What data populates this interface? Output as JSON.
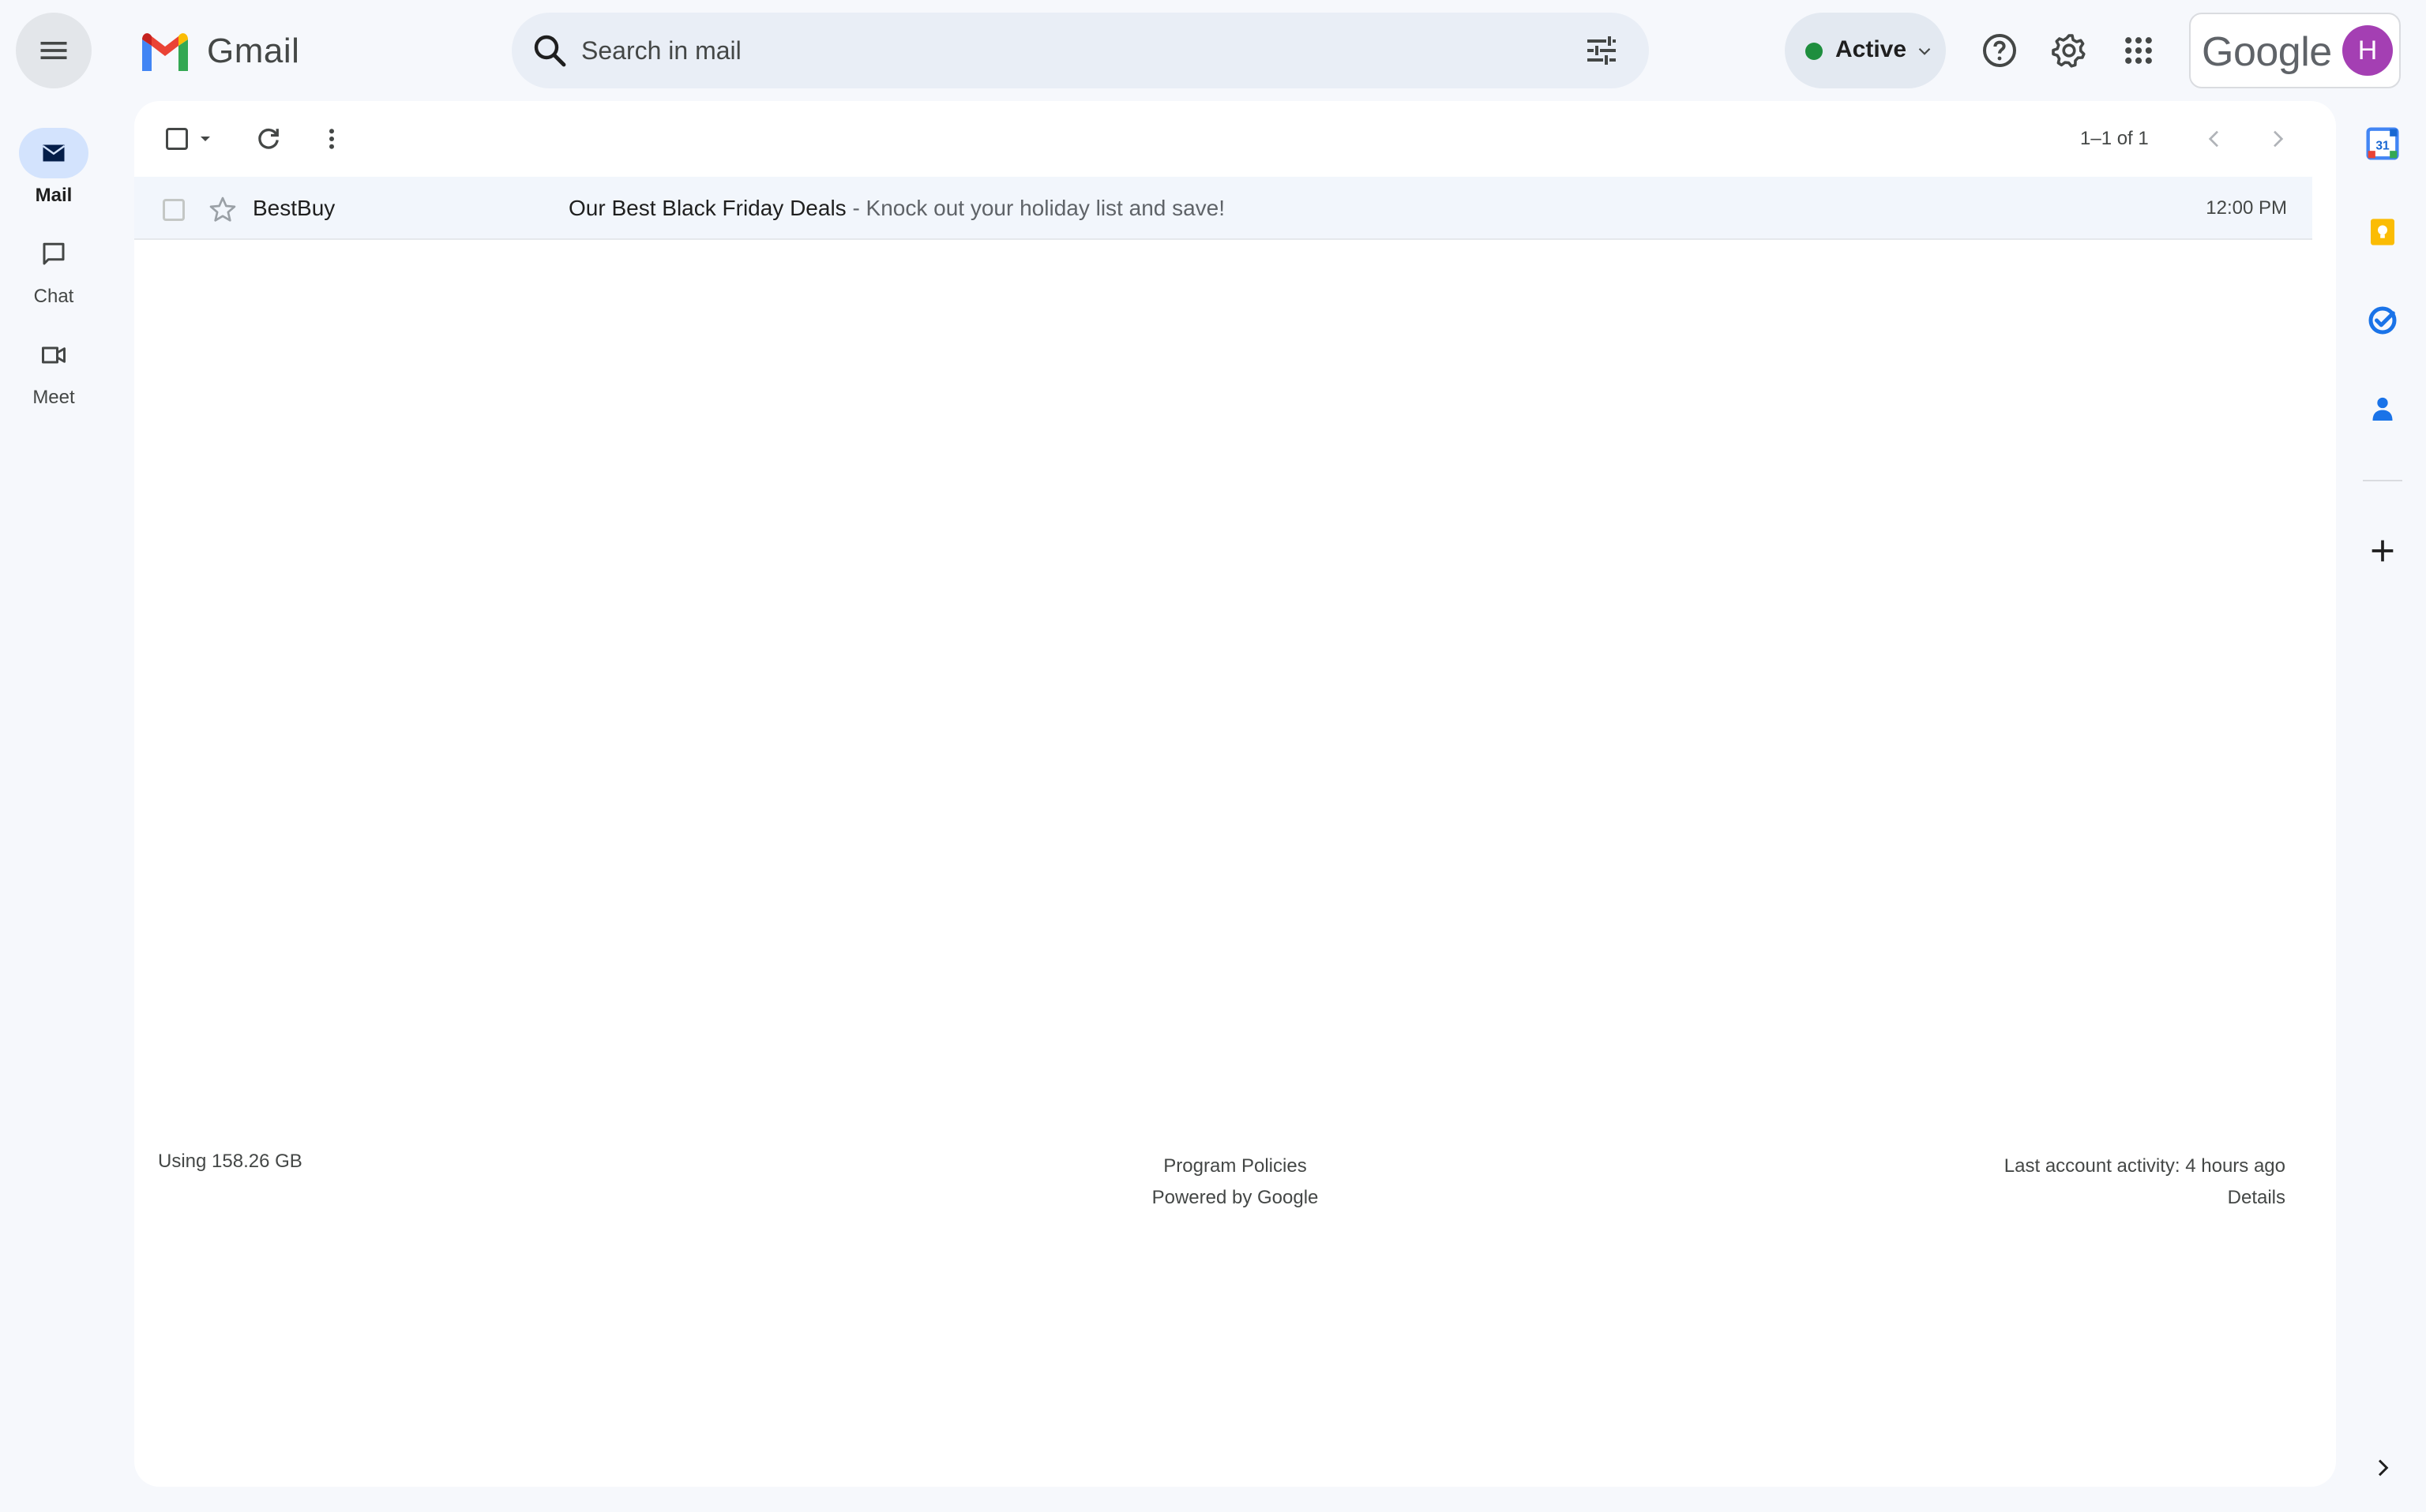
{
  "header": {
    "app_name": "Gmail",
    "search_placeholder": "Search in mail",
    "status_label": "Active",
    "account_brand": "Google",
    "avatar_initial": "H"
  },
  "rail": {
    "items": [
      {
        "label": "Mail",
        "icon": "mail-icon",
        "active": true
      },
      {
        "label": "Chat",
        "icon": "chat-icon",
        "active": false
      },
      {
        "label": "Meet",
        "icon": "meet-icon",
        "active": false
      }
    ]
  },
  "toolbar": {
    "page_count": "1–1 of 1"
  },
  "emails": [
    {
      "sender": "BestBuy",
      "subject": "Our Best Black Friday Deals",
      "snippet": " - Knock out your holiday list and save!",
      "time": "12:00 PM"
    }
  ],
  "footer": {
    "storage": "Using 158.26 GB",
    "program_policies": "Program Policies",
    "powered_by": "Powered by Google",
    "last_activity": "Last account activity: 4 hours ago",
    "details": "Details"
  },
  "side_panel": {
    "calendar_day": "31",
    "icons": [
      "calendar-icon",
      "keep-icon",
      "tasks-icon",
      "contacts-icon",
      "add-icon"
    ]
  },
  "colors": {
    "background": "#f6f8fc",
    "active_status": "#1e8e3e",
    "avatar": "#a43fb3",
    "selected_rail": "#d3e3fd"
  }
}
